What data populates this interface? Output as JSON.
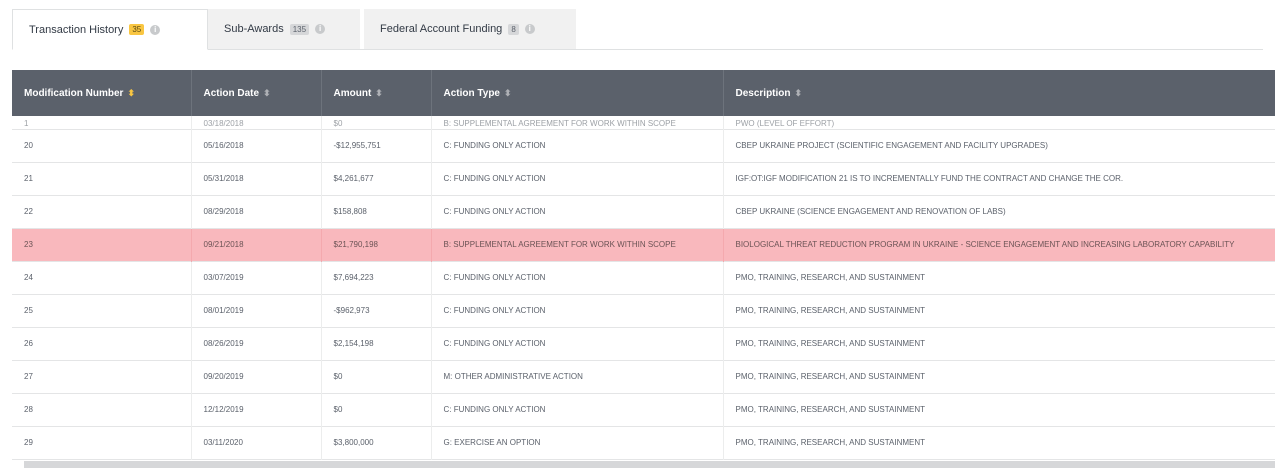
{
  "tabs": [
    {
      "label": "Transaction History",
      "count": "35",
      "active": true
    },
    {
      "label": "Sub-Awards",
      "count": "135",
      "active": false
    },
    {
      "label": "Federal Account Funding",
      "count": "8",
      "active": false
    }
  ],
  "table": {
    "columns": [
      "Modification Number",
      "Action Date",
      "Amount",
      "Action Type",
      "Description"
    ],
    "partial_row": [
      "1",
      "03/18/2018",
      "$0",
      "B: SUPPLEMENTAL AGREEMENT FOR WORK WITHIN SCOPE",
      "PWO (LEVEL OF EFFORT)"
    ],
    "rows": [
      [
        "20",
        "05/16/2018",
        "-$12,955,751",
        "C: FUNDING ONLY ACTION",
        "CBEP UKRAINE PROJECT (SCIENTIFIC ENGAGEMENT AND FACILITY UPGRADES)"
      ],
      [
        "21",
        "05/31/2018",
        "$4,261,677",
        "C: FUNDING ONLY ACTION",
        "IGF:OT:IGF MODIFICATION 21 IS TO INCREMENTALLY FUND THE CONTRACT AND CHANGE THE COR."
      ],
      [
        "22",
        "08/29/2018",
        "$158,808",
        "C: FUNDING ONLY ACTION",
        "CBEP UKRAINE (SCIENCE ENGAGEMENT AND RENOVATION OF LABS)"
      ],
      [
        "23",
        "09/21/2018",
        "$21,790,198",
        "B: SUPPLEMENTAL AGREEMENT FOR WORK WITHIN SCOPE",
        "BIOLOGICAL THREAT REDUCTION PROGRAM IN UKRAINE - SCIENCE ENGAGEMENT AND INCREASING LABORATORY CAPABILITY"
      ],
      [
        "24",
        "03/07/2019",
        "$7,694,223",
        "C: FUNDING ONLY ACTION",
        "PMO, TRAINING, RESEARCH, AND SUSTAINMENT"
      ],
      [
        "25",
        "08/01/2019",
        "-$962,973",
        "C: FUNDING ONLY ACTION",
        "PMO, TRAINING, RESEARCH, AND SUSTAINMENT"
      ],
      [
        "26",
        "08/26/2019",
        "$2,154,198",
        "C: FUNDING ONLY ACTION",
        "PMO, TRAINING, RESEARCH, AND SUSTAINMENT"
      ],
      [
        "27",
        "09/20/2019",
        "$0",
        "M: OTHER ADMINISTRATIVE ACTION",
        "PMO, TRAINING, RESEARCH, AND SUSTAINMENT"
      ],
      [
        "28",
        "12/12/2019",
        "$0",
        "C: FUNDING ONLY ACTION",
        "PMO, TRAINING, RESEARCH, AND SUSTAINMENT"
      ],
      [
        "29",
        "03/11/2020",
        "$3,800,000",
        "G: EXERCISE AN OPTION",
        "PMO, TRAINING, RESEARCH, AND SUSTAINMENT"
      ]
    ],
    "highlight_row_index": 3
  },
  "icons": {
    "info": "info-circle-icon",
    "sort": "sort-arrows-icon"
  },
  "colors": {
    "header_bg": "#5b616b",
    "highlight_row": "#f9b8bd",
    "badge_active": "#f9c642"
  }
}
